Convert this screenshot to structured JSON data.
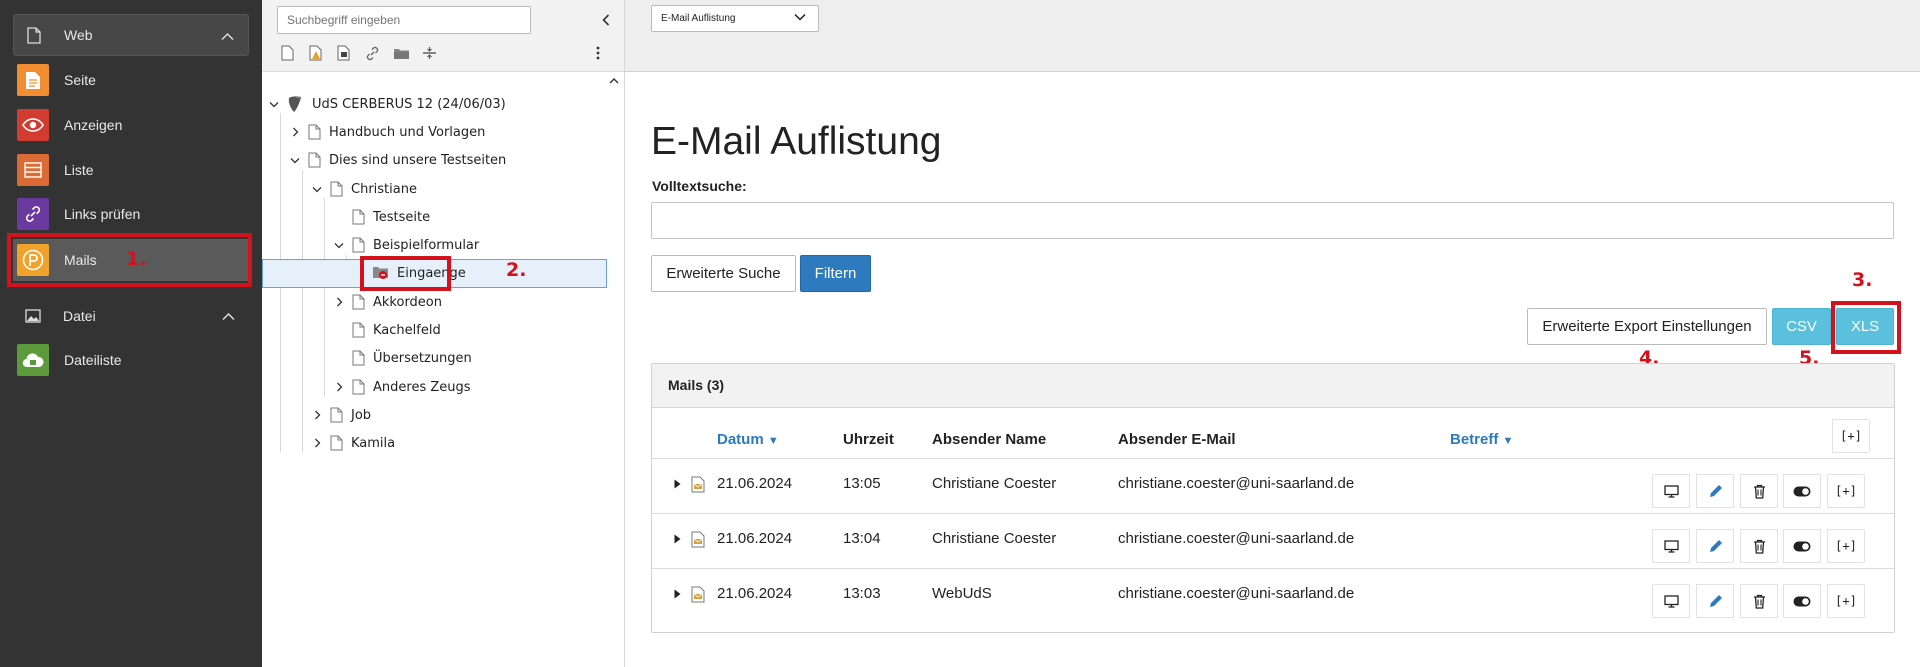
{
  "modules": {
    "web_group": {
      "label": "Web"
    },
    "items": [
      {
        "label": "Seite",
        "color": "#f38d31"
      },
      {
        "label": "Anzeigen",
        "color": "#d23b2f"
      },
      {
        "label": "Liste",
        "color": "#dc6a34"
      },
      {
        "label": "Links prüfen",
        "color": "#6a3aa0"
      },
      {
        "label": "Mails",
        "color": "#f0a22a"
      }
    ],
    "datei_group": {
      "label": "Datei"
    },
    "datei_items": [
      {
        "label": "Dateiliste",
        "color": "#5c9a3c"
      }
    ]
  },
  "annotations": {
    "n1": "1.",
    "n2": "2.",
    "n3": "3.",
    "n4": "4.",
    "n5": "5.",
    "color": "#d4121e"
  },
  "tree": {
    "search_placeholder": "Suchbegriff eingeben",
    "toolbar_icons": [
      "new-page-icon",
      "new-page-doktype-icon",
      "new-page-content-icon",
      "link-icon",
      "folder-icon",
      "divider-icon"
    ],
    "root": "UdS CERBERUS 12 (24/06/03)",
    "nodes": [
      {
        "label": "Handbuch und Vorlagen"
      },
      {
        "label": "Dies sind unsere Testseiten"
      },
      {
        "label": "Christiane"
      },
      {
        "label": "Testseite"
      },
      {
        "label": "Beispielformular"
      },
      {
        "label": "Eingaenge"
      },
      {
        "label": "Akkordeon"
      },
      {
        "label": "Kachelfeld"
      },
      {
        "label": "Übersetzungen"
      },
      {
        "label": "Anderes Zeugs"
      },
      {
        "label": "Job"
      },
      {
        "label": "Kamila"
      }
    ]
  },
  "header": {
    "view_select": "E-Mail Auflistung"
  },
  "main": {
    "title": "E-Mail Auflistung",
    "search_label": "Volltextsuche:",
    "search_value": "",
    "advanced_search": "Erweiterte Suche",
    "filter": "Filtern",
    "export_settings": "Erweiterte Export Einstellungen",
    "csv": "CSV",
    "xls": "XLS",
    "panel_title": "Mails (3)",
    "columns": {
      "datum": "Datum",
      "uhrzeit": "Uhrzeit",
      "name": "Absender Name",
      "email": "Absender E-Mail",
      "betreff": "Betreff"
    },
    "rows": [
      {
        "date": "21.06.2024",
        "time": "13:05",
        "name": "Christiane Coester",
        "email": "christiane.coester@uni-saarland.de",
        "subject": ""
      },
      {
        "date": "21.06.2024",
        "time": "13:04",
        "name": "Christiane Coester",
        "email": "christiane.coester@uni-saarland.de",
        "subject": ""
      },
      {
        "date": "21.06.2024",
        "time": "13:03",
        "name": "WebUdS",
        "email": "christiane.coester@uni-saarland.de",
        "subject": ""
      }
    ],
    "accent_color": "#2d7abf",
    "info_color": "#5bc0de"
  }
}
